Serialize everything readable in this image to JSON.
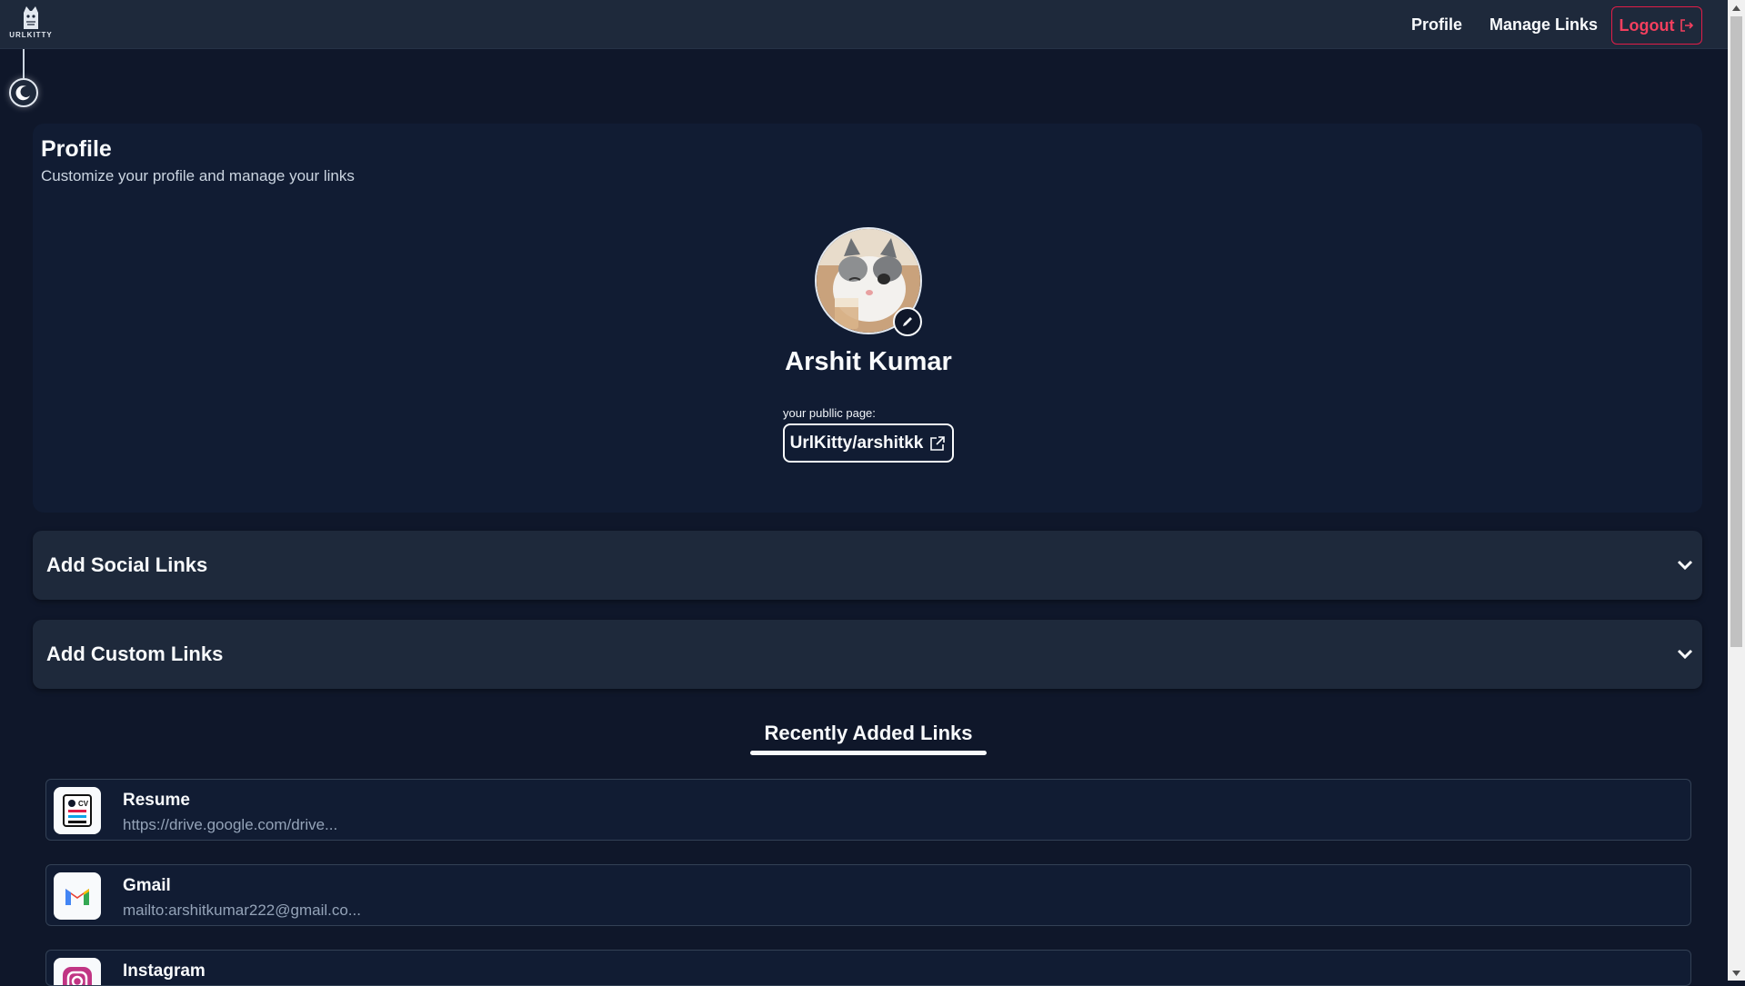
{
  "brand": {
    "logo_text": "URLKITTY",
    "logo_icon": "cat-logo-icon"
  },
  "nav": {
    "profile": "Profile",
    "manage_links": "Manage Links",
    "logout": "Logout"
  },
  "profile": {
    "title": "Profile",
    "subtitle": "Customize your profile and manage your links",
    "name": "Arshit Kumar",
    "public_label": "your publlic page:",
    "public_link": "UrlKitty/arshitkk"
  },
  "accordions": {
    "social": "Add Social Links",
    "custom": "Add Custom Links"
  },
  "recent": {
    "heading": "Recently Added Links",
    "items": [
      {
        "title": "Resume",
        "url": "https://drive.google.com/drive...",
        "icon": "resume-cv-icon"
      },
      {
        "title": "Gmail",
        "url": "mailto:arshitkumar222@gmail.co...",
        "icon": "gmail-icon"
      },
      {
        "title": "Instagram",
        "url": "",
        "icon": "instagram-icon"
      }
    ]
  },
  "colors": {
    "background": "#0f172a",
    "navbar": "#1e293b",
    "card": "#111c33",
    "logout": "#f43f5e",
    "text_muted": "#94a3b8"
  }
}
